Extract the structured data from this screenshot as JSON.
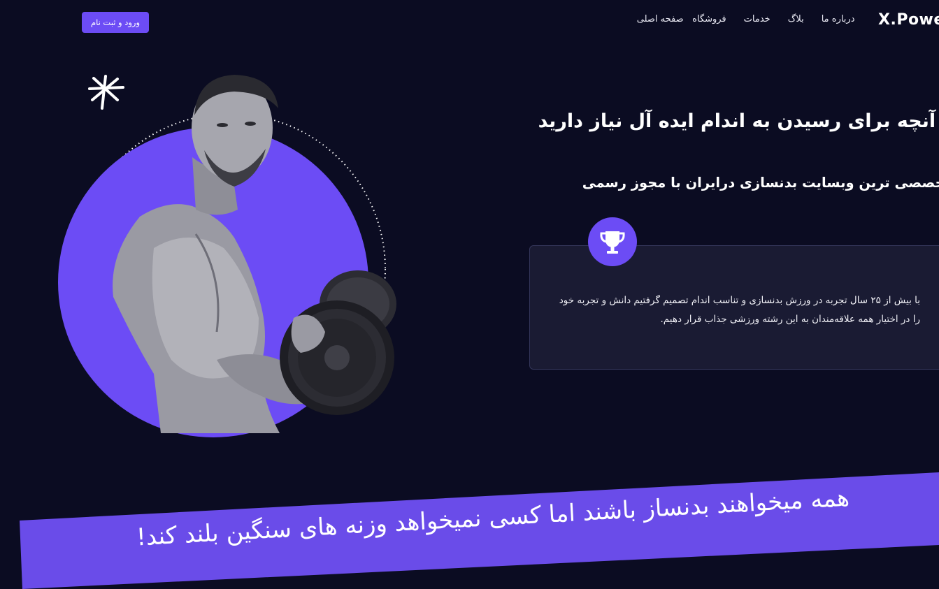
{
  "nav": {
    "logo": "X.Power",
    "items": [
      {
        "label": "صفحه اصلی"
      },
      {
        "label": "فروشگاه"
      },
      {
        "label": "خدمات"
      },
      {
        "label": "بلاگ"
      },
      {
        "label": "درباره ما"
      }
    ],
    "login_label": "ورود و ثبت نام"
  },
  "hero": {
    "headline": "هر آنچه برای رسیدن به اندام ایده آل نیاز دارید",
    "subheadline": "تخصصی ترین وبسایت بدنسازی درایران با مجوز رسمی",
    "card_icon": "trophy-icon",
    "card_text": "با بیش از ۲۵ سال تجربه در ورزش بدنسازی و تناسب اندام تصمیم گرفتیم دانش و تجربه خود را در اختیار همه علاقه‌مندان به این رشته ورزشی جذاب قرار دهیم.",
    "image_icon": "bodybuilder-image"
  },
  "banner": {
    "text": "همه میخواهند بدنساز باشند اما کسی نمیخواهد وزنه های سنگین بلند کند!"
  },
  "colors": {
    "background": "#0b0c22",
    "accent": "#6c4cf5",
    "card": "#1a1b33"
  }
}
